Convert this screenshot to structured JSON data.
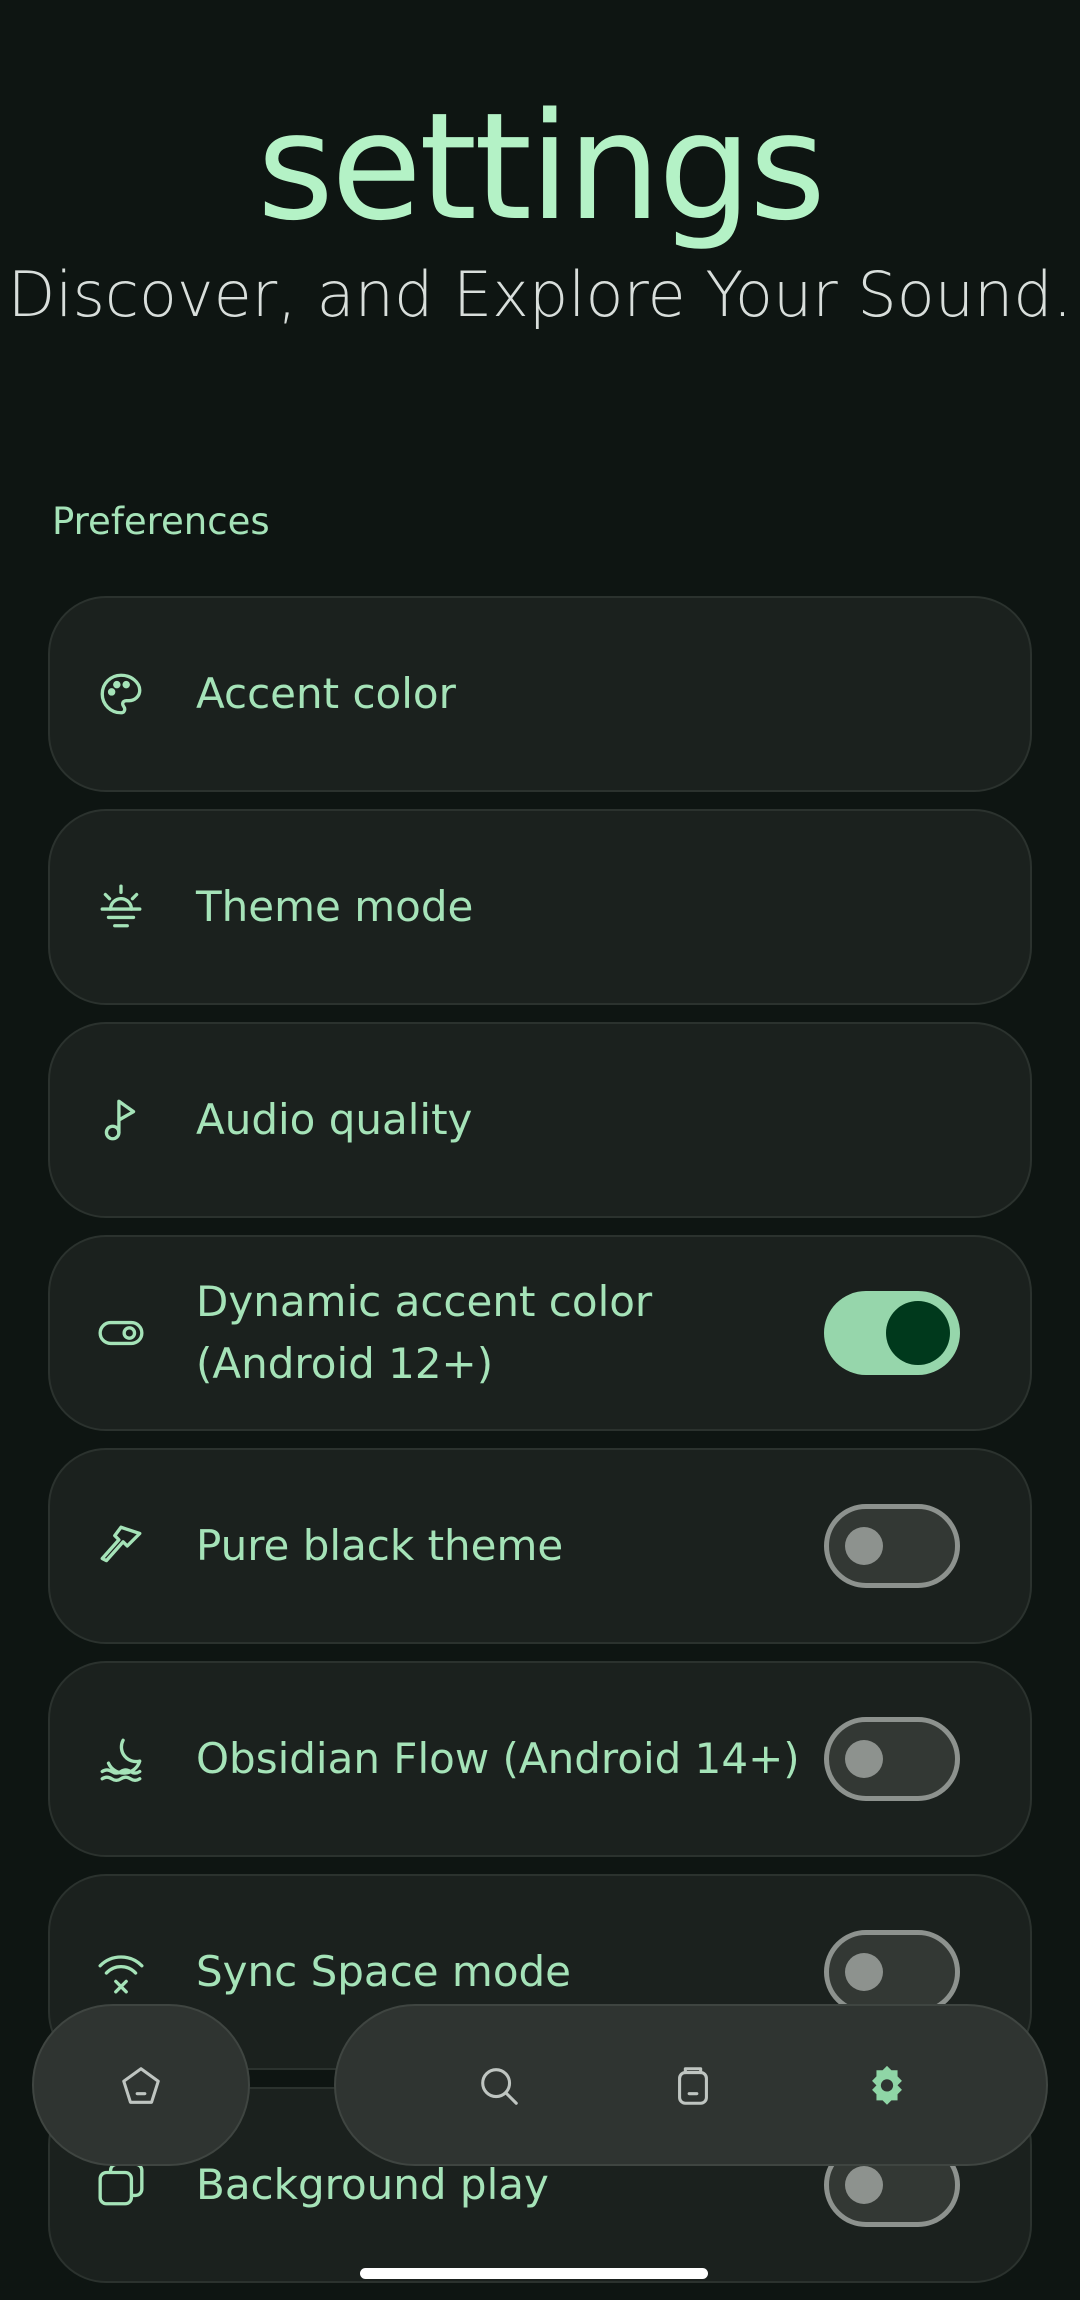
{
  "header": {
    "title": "settings",
    "subtitle": "Discover, and Explore Your Sound."
  },
  "section": {
    "title": "Preferences"
  },
  "settings": [
    {
      "label": "Accent color",
      "icon": "palette-icon",
      "toggle": null
    },
    {
      "label": "Theme mode",
      "icon": "sunrise-icon",
      "toggle": null
    },
    {
      "label": "Audio quality",
      "icon": "music-note-icon",
      "toggle": null
    },
    {
      "label": "Dynamic accent color (Android 12+)",
      "icon": "toggle-icon",
      "toggle": true
    },
    {
      "label": "Pure black theme",
      "icon": "brush-icon",
      "toggle": false
    },
    {
      "label": "Obsidian Flow (Android 14+)",
      "icon": "moon-waves-icon",
      "toggle": false
    },
    {
      "label": "Sync Space mode",
      "icon": "wifi-off-icon",
      "toggle": false
    },
    {
      "label": "Background play",
      "icon": "layers-icon",
      "toggle": false
    }
  ],
  "nav": {
    "items": [
      {
        "icon": "home-pentagon-icon",
        "active": false
      },
      {
        "icon": "search-icon",
        "active": false
      },
      {
        "icon": "library-icon",
        "active": false
      },
      {
        "icon": "settings-gear-icon",
        "active": true
      }
    ]
  },
  "colors": {
    "background": "#0e1512",
    "accent": "#a5e3b8",
    "card": "#1b211e",
    "toggle_on": "#96d6ab",
    "nav": "#2f3431"
  }
}
